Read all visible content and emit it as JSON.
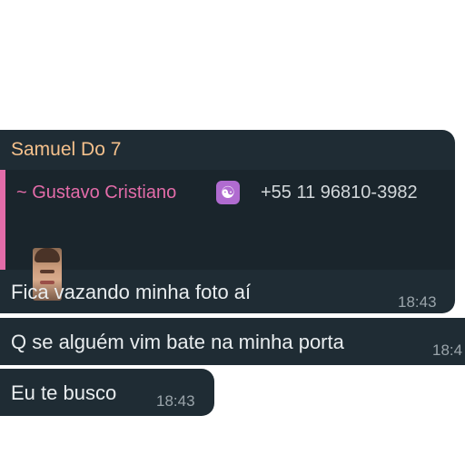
{
  "messages": [
    {
      "sender": "Samuel Do 7",
      "quote": {
        "author": "~ Gustavo Cristiano",
        "author_icon": "yin-yang-icon",
        "phone": "+55 11 96810-3982",
        "has_photo_thumbnail": true
      },
      "text": "Fica vazando minha foto aí",
      "time": "18:43"
    },
    {
      "text": "Q se alguém vim bate na minha porta",
      "time": "18:4"
    },
    {
      "text": "Eu te busco",
      "time": "18:43"
    }
  ],
  "colors": {
    "page_background": "#ffffff",
    "bubble_background": "#1f2c34",
    "sender_name": "#f5c18c",
    "quote_accent": "#e36ca9",
    "timestamp": "#9aa4aa"
  }
}
